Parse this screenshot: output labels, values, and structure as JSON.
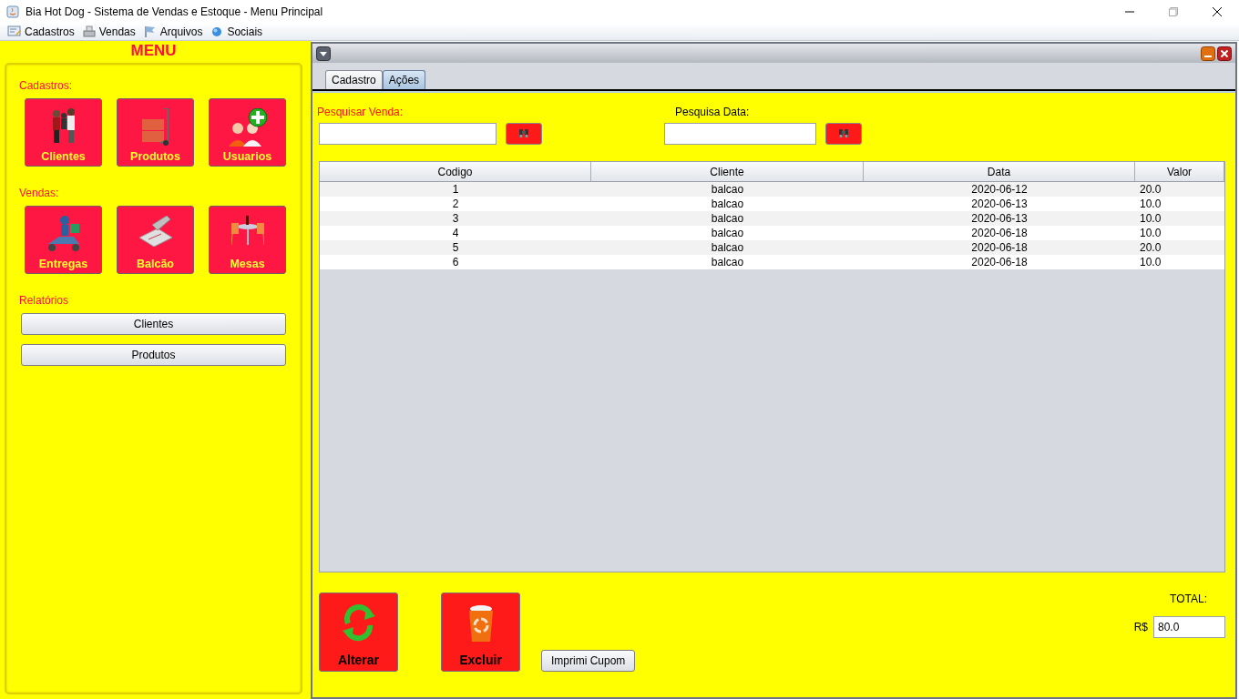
{
  "window": {
    "title": "Bia Hot Dog - Sistema de Vendas e Estoque - Menu Principal"
  },
  "menu_bar": [
    {
      "label": "Cadastros",
      "kind": "form"
    },
    {
      "label": "Vendas",
      "kind": "register"
    },
    {
      "label": "Arquivos",
      "kind": "flag"
    },
    {
      "label": "Sociais",
      "kind": "globe"
    }
  ],
  "side_menu": {
    "title": "MENU",
    "sections": [
      {
        "label": "Cadastros:",
        "kind": "tiles",
        "items": [
          {
            "label": "Clientes",
            "kind": "people"
          },
          {
            "label": "Produtos",
            "kind": "cart"
          },
          {
            "label": "Usuarios",
            "kind": "adduser"
          }
        ]
      },
      {
        "label": "Vendas:",
        "kind": "tiles",
        "items": [
          {
            "label": "Entregas",
            "kind": "scooter"
          },
          {
            "label": "Balcão",
            "kind": "scanner"
          },
          {
            "label": "Mesas",
            "kind": "table"
          }
        ]
      },
      {
        "label": "Relatórios",
        "kind": "buttons",
        "items": [
          {
            "label": "Clientes"
          },
          {
            "label": "Produtos"
          }
        ]
      }
    ]
  },
  "internal_frame": {
    "tabs": [
      {
        "label": "Cadastro",
        "selected": false
      },
      {
        "label": "Ações",
        "selected": true
      }
    ],
    "search_sale": {
      "label": "Pesquisar Venda:"
    },
    "search_date": {
      "label": "Pesquisa Data:"
    },
    "table": {
      "columns": [
        "Codigo",
        "Cliente",
        "Data",
        "Valor"
      ],
      "rows": [
        [
          "1",
          "balcao",
          "2020-06-12",
          "20.0"
        ],
        [
          "2",
          "balcao",
          "2020-06-13",
          "10.0"
        ],
        [
          "3",
          "balcao",
          "2020-06-13",
          "10.0"
        ],
        [
          "4",
          "balcao",
          "2020-06-18",
          "10.0"
        ],
        [
          "5",
          "balcao",
          "2020-06-18",
          "20.0"
        ],
        [
          "6",
          "balcao",
          "2020-06-18",
          "10.0"
        ]
      ]
    },
    "actions": [
      {
        "label": "Alterar",
        "kind": "refresh"
      },
      {
        "label": "Excluir",
        "kind": "trash"
      }
    ],
    "print_button": "Imprimi Cupom",
    "total": {
      "label": "TOTAL:",
      "currency": "R$",
      "value": "80.0"
    }
  }
}
